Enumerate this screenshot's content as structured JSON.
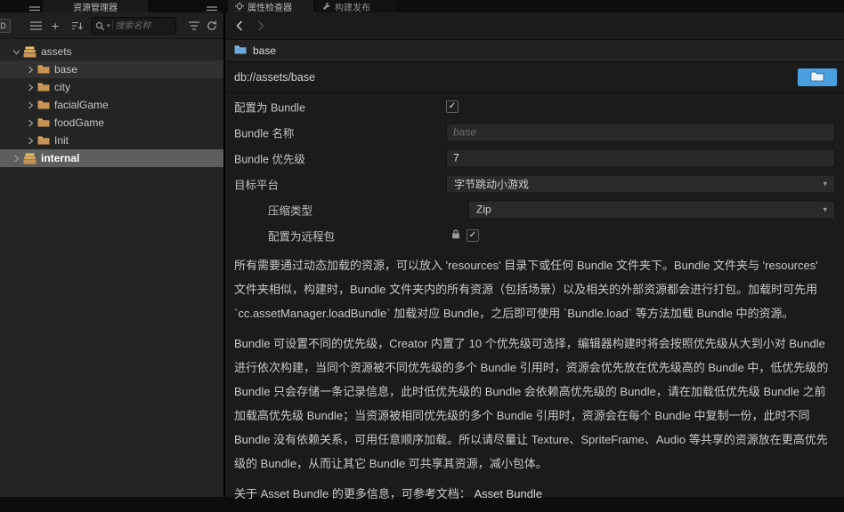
{
  "tabbar": {
    "assets_tab": "资源管理器",
    "inspector_tab": "属性检查器",
    "build_tab": "构建发布"
  },
  "assets_panel": {
    "toolbar": {
      "d_button": "D",
      "search_placeholder": "搜索名称"
    },
    "tree": [
      {
        "label": "assets",
        "icon": "stack",
        "chevron": "down",
        "indent": 0,
        "state": "normal"
      },
      {
        "label": "base",
        "icon": "folder",
        "chevron": "right",
        "indent": 1,
        "state": "soft"
      },
      {
        "label": "city",
        "icon": "folder",
        "chevron": "right",
        "indent": 1,
        "state": "normal"
      },
      {
        "label": "facialGame",
        "icon": "folder",
        "chevron": "right",
        "indent": 1,
        "state": "normal"
      },
      {
        "label": "foodGame",
        "icon": "folder",
        "chevron": "right",
        "indent": 1,
        "state": "normal"
      },
      {
        "label": "Init",
        "icon": "folder",
        "chevron": "right",
        "indent": 1,
        "state": "normal"
      },
      {
        "label": "internal",
        "icon": "stack",
        "chevron": "right",
        "indent": 0,
        "state": "selected"
      }
    ]
  },
  "inspector": {
    "breadcrumb": "base",
    "path": "db://assets/base",
    "fields": {
      "is_bundle": {
        "label": "配置为 Bundle",
        "checked": true
      },
      "bundle_name": {
        "label": "Bundle 名称",
        "placeholder": "base",
        "value": ""
      },
      "bundle_priority": {
        "label": "Bundle 优先级",
        "value": "7"
      },
      "target_platform": {
        "label": "目标平台",
        "value": "字节跳动小游戏"
      },
      "compression_type": {
        "label": "压缩类型",
        "value": "Zip"
      },
      "is_remote": {
        "label": "配置为远程包",
        "checked": true,
        "locked": true
      }
    },
    "description": {
      "p1": "所有需要通过动态加载的资源，可以放入 'resources' 目录下或任何 Bundle 文件夹下。Bundle 文件夹与 'resources' 文件夹相似，构建时，Bundle 文件夹内的所有资源（包括场景）以及相关的外部资源都会进行打包。加载时可先用 `cc.assetManager.loadBundle` 加载对应 Bundle，之后即可使用 `Bundle.load` 等方法加载 Bundle 中的资源。",
      "p2": "Bundle 可设置不同的优先级，Creator 内置了 10 个优先级可选择，编辑器构建时将会按照优先级从大到小对 Bundle 进行依次构建，当同个资源被不同优先级的多个 Bundle 引用时，资源会优先放在优先级高的 Bundle 中，低优先级的 Bundle 只会存储一条记录信息，此时低优先级的 Bundle 会依赖高优先级的 Bundle，请在加载低优先级 Bundle 之前加载高优先级 Bundle；当资源被相同优先级的多个 Bundle 引用时，资源会在每个 Bundle 中复制一份，此时不同 Bundle 没有依赖关系，可用任意顺序加载。所以请尽量让 Texture、SpriteFrame、Audio 等共享的资源放在更高优先级的 Bundle，从而让其它 Bundle 可共享其资源，减小包体。",
      "p3_text": "关于 Asset Bundle 的更多信息，可参考文档：",
      "p3_link": "Asset Bundle"
    },
    "colors": {
      "accent_blue": "#4a9fe0",
      "folder_amber": "#c79456",
      "selection_gray": "#5e5e5e"
    }
  }
}
